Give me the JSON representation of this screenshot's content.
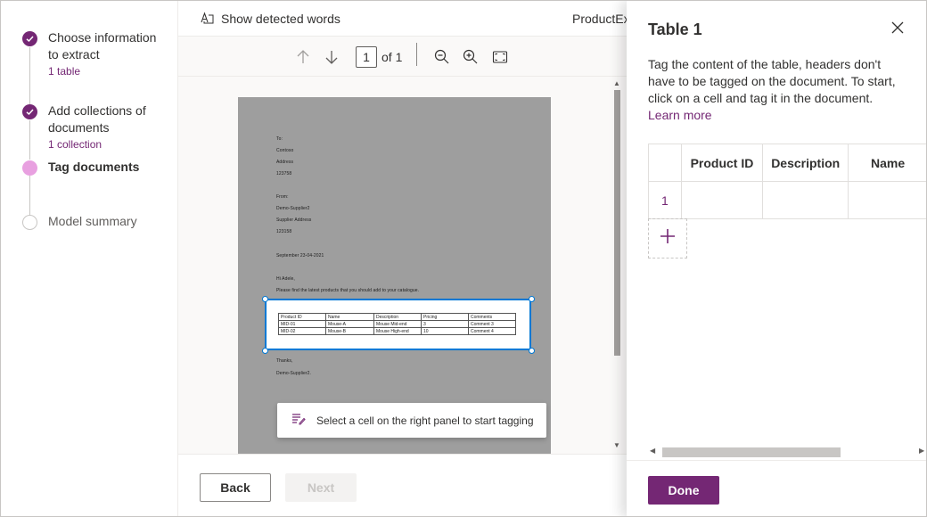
{
  "stepper": {
    "steps": [
      {
        "title": "Choose information to extract",
        "subtitle": "1 table",
        "state": "done"
      },
      {
        "title": "Add collections of documents",
        "subtitle": "1 collection",
        "state": "done"
      },
      {
        "title": "Tag documents",
        "subtitle": "",
        "state": "active"
      },
      {
        "title": "Model summary",
        "subtitle": "",
        "state": "pending"
      }
    ]
  },
  "topbar": {
    "show_words_label": "Show detected words",
    "document_name": "ProductEx"
  },
  "toolbar": {
    "page_number": "1",
    "page_of": "of 1",
    "icons": [
      "arrow-up-icon",
      "arrow-down-icon",
      "zoom-out-icon",
      "zoom-in-icon",
      "fit-page-icon"
    ]
  },
  "document": {
    "lines": {
      "to": "To:",
      "to_name": "Contoso",
      "to_address": "Address",
      "to_zip": "123758",
      "from": "From:",
      "from_name": "Demo-Supplier2",
      "from_address": "Supplier Address",
      "from_zip": "123158",
      "date": "September 23-04-2021",
      "greeting": "Hi Adele,",
      "body": "Please find the latest products that you should add to your catalogue.",
      "thanks": "Thanks,",
      "signature": "Demo-Supplier2."
    },
    "table": {
      "headers": [
        "Product ID",
        "Name",
        "Description",
        "Pricing",
        "Comments"
      ],
      "rows": [
        [
          "MID-01",
          "Mouse-A",
          "Mouse Mid-end",
          "3",
          "Comment 3"
        ],
        [
          "MID-02",
          "Mouse-B",
          "Mouse High-end",
          "10",
          "Comment 4"
        ]
      ]
    }
  },
  "toast": {
    "message": "Select a cell on the right panel to start tagging"
  },
  "footer": {
    "back_label": "Back",
    "next_label": "Next"
  },
  "panel": {
    "title": "Table 1",
    "description": "Tag the content of the table, headers don't have to be tagged on the document. To start, click on a cell and tag it in the document.",
    "learn_more": "Learn more",
    "columns": [
      "Product ID",
      "Description",
      "Name"
    ],
    "rows": [
      {
        "number": "1"
      }
    ],
    "done_label": "Done"
  },
  "colors": {
    "accent": "#742774",
    "active_step": "#e8a0e0",
    "selection": "#0078d4"
  }
}
